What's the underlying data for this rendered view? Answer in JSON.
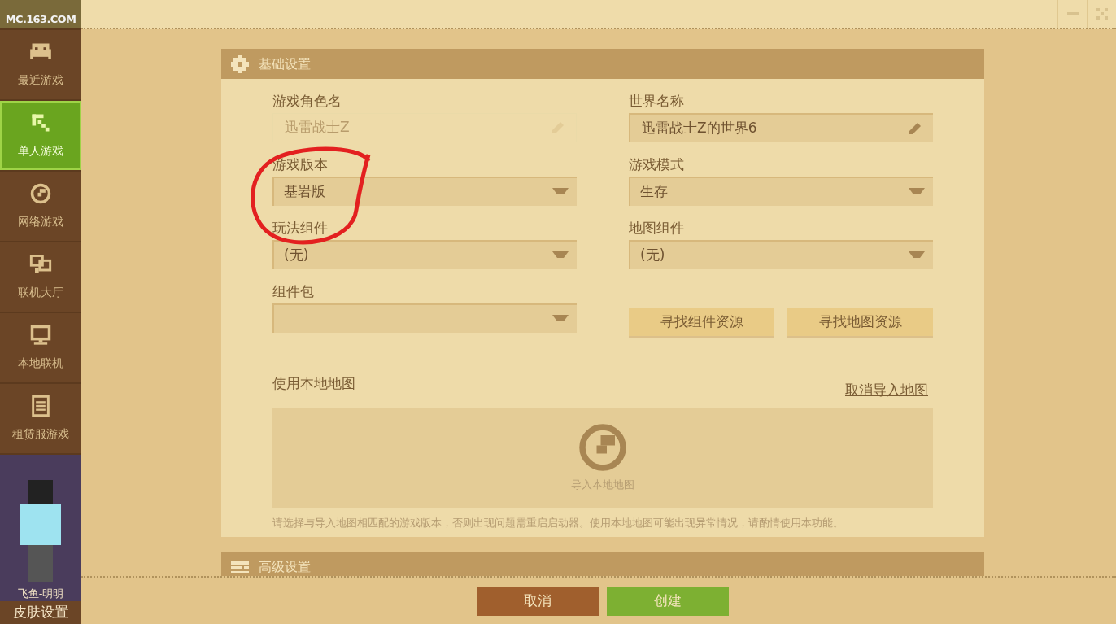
{
  "sidebar": {
    "logo": "MC.163.COM",
    "items": [
      {
        "label": "最近游戏",
        "selected": false
      },
      {
        "label": "单人游戏",
        "selected": true
      },
      {
        "label": "网络游戏",
        "selected": false
      },
      {
        "label": "联机大厅",
        "selected": false
      },
      {
        "label": "本地联机",
        "selected": false
      },
      {
        "label": "租赁服游戏",
        "selected": false
      }
    ],
    "profile": {
      "name": "飞鱼-明明",
      "skin_button": "皮肤设置"
    }
  },
  "basic_settings": {
    "title": "基础设置",
    "left_fields": [
      {
        "kind": "text",
        "label": "游戏角色名",
        "value": "迅雷战士Z",
        "disabled": true
      },
      {
        "kind": "select",
        "label": "游戏版本",
        "value": "基岩版"
      },
      {
        "kind": "select",
        "label": "玩法组件",
        "value": "(无)"
      },
      {
        "kind": "select",
        "label": "组件包"
      }
    ],
    "right_fields": [
      {
        "kind": "text",
        "label": "世界名称",
        "value": "迅雷战士Z的世界6",
        "disabled": false
      },
      {
        "kind": "select",
        "label": "游戏模式",
        "value": "生存"
      },
      {
        "kind": "select",
        "label": "地图组件",
        "value": "(无)"
      }
    ],
    "resource_buttons": [
      "寻找组件资源",
      "寻找地图资源"
    ],
    "local_map": {
      "label": "使用本地地图",
      "cancel_link": "取消导入地图",
      "drop_label": "导入本地地图",
      "note": "请选择与导入地图相匹配的游戏版本，否则出现问题需重启启动器。使用本地地图可能出现异常情况，请酌情使用本功能。"
    }
  },
  "advanced_settings": {
    "title": "高级设置"
  },
  "footer_buttons": [
    {
      "label": "取消",
      "kind": "cancel"
    },
    {
      "label": "创建",
      "kind": "primary"
    }
  ]
}
